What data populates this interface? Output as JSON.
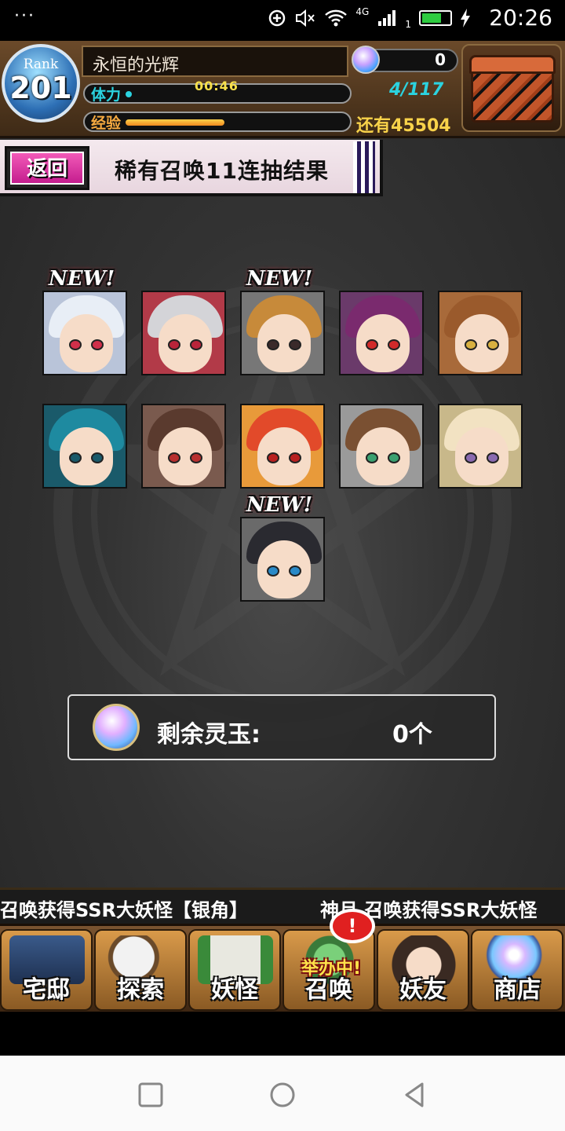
{
  "status_bar": {
    "dots": "···",
    "signal_label": "4G",
    "sim_index": "1",
    "time": "20:26"
  },
  "hud": {
    "rank_label": "Rank",
    "rank_value": "201",
    "player_name": "永恒的光辉",
    "stamina_label": "体力",
    "stamina_timer": "00:46",
    "stamina_fraction": 0.03,
    "exp_label": "经验",
    "exp_fraction": 0.45,
    "jade_count": "0",
    "friends": "4/117",
    "remaining_label": "还有",
    "remaining_value": "45504"
  },
  "banner": {
    "back_label": "返回",
    "title": "稀有召唤11连抽结果"
  },
  "results": {
    "new_label": "NEW!",
    "cards": [
      {
        "new": true,
        "hair": "#e8eef6",
        "bg": "#b9c4d9",
        "eye": "#d0304a"
      },
      {
        "new": false,
        "hair": "#d4d4d8",
        "bg": "#b23a48",
        "eye": "#b9243a"
      },
      {
        "new": true,
        "hair": "#c78a3a",
        "bg": "#777777",
        "eye": "#3a2a2a"
      },
      {
        "new": false,
        "hair": "#7a2a6e",
        "bg": "#6a3a6a",
        "eye": "#d12a2a"
      },
      {
        "new": false,
        "hair": "#9a5a2c",
        "bg": "#a86a3a",
        "eye": "#d8b040"
      },
      {
        "new": false,
        "hair": "#1e8aa0",
        "bg": "#1a5a6a",
        "eye": "#1a5a6a"
      },
      {
        "new": false,
        "hair": "#5a3a2e",
        "bg": "#7a5a4e",
        "eye": "#b83030"
      },
      {
        "new": false,
        "hair": "#e24a2a",
        "bg": "#e89a3a",
        "eye": "#b82020"
      },
      {
        "new": false,
        "hair": "#7a5032",
        "bg": "#9a9a9a",
        "eye": "#3aa070"
      },
      {
        "new": false,
        "hair": "#f2e2c2",
        "bg": "#c8b88a",
        "eye": "#8a6ab0"
      },
      {
        "new": true,
        "hair": "#2a2a30",
        "bg": "#6a6a6a",
        "eye": "#2a8ac8"
      }
    ]
  },
  "jade_panel": {
    "label": "剩余灵玉:",
    "value": "0个"
  },
  "ticker": {
    "message_1": "召唤获得SSR大妖怪【银角】",
    "message_2": "神月 召唤获得SSR大妖怪"
  },
  "nav": {
    "items": [
      {
        "label": "宅邸",
        "tag": ""
      },
      {
        "label": "探索",
        "tag": ""
      },
      {
        "label": "妖怪",
        "tag": ""
      },
      {
        "label": "召唤",
        "tag": "举办中!",
        "alert": "!"
      },
      {
        "label": "妖友",
        "tag": ""
      },
      {
        "label": "商店",
        "tag": ""
      }
    ]
  },
  "colors": {
    "accent_pink": "#e0349e",
    "stamina": "#2bd3e0",
    "exp": "#f5a940",
    "gold_text": "#f8d24a"
  }
}
